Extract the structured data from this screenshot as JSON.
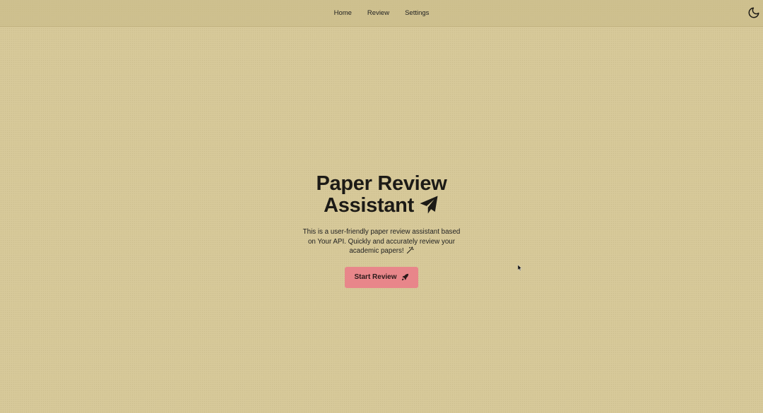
{
  "nav": {
    "links": [
      "Home",
      "Review",
      "Settings"
    ],
    "theme_toggle_icon": "moon-icon"
  },
  "hero": {
    "title_line1": "Paper Review",
    "title_line2": "Assistant",
    "title_icon": "paper-plane-icon",
    "description": "This is a user-friendly paper review assistant based on Your API. Quickly and accurately review your academic papers!",
    "description_icon": "magic-wand-icon",
    "button_label": "Start Review",
    "button_icon": "rocket-icon"
  },
  "colors": {
    "background": "#d6c898",
    "button": "#e8868a",
    "text": "#1c1a16"
  }
}
